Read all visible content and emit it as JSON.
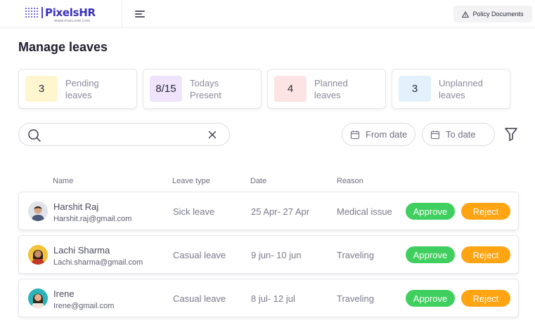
{
  "brand": {
    "name": "PixelsHR",
    "tagline": "WWW.PIXELSHR.COM"
  },
  "header": {
    "policy_label": "Policy Documents"
  },
  "page": {
    "title": "Manage leaves"
  },
  "stats": [
    {
      "value": "3",
      "label": "Pending leaves",
      "color": "#fff6cf"
    },
    {
      "value": "8/15",
      "label": "Todays Present",
      "color": "#efe4fb"
    },
    {
      "value": "4",
      "label": "Planned leaves",
      "color": "#fde4e4"
    },
    {
      "value": "3",
      "label": "Unplanned leaves",
      "color": "#e3f1fd"
    }
  ],
  "filters": {
    "search_value": "",
    "from_date_label": "From date",
    "to_date_label": "To date"
  },
  "table": {
    "columns": [
      "Name",
      "Leave type",
      "Date",
      "Reason"
    ],
    "approve_label": "Approve",
    "reject_label": "Reject",
    "rows": [
      {
        "name": "Harshit Raj",
        "email": "Harshit.raj@gmail.com",
        "leave_type": "Sick leave",
        "date": "25 Apr- 27 Apr",
        "reason": "Medical issue"
      },
      {
        "name": "Lachi Sharma",
        "email": "Lachi.sharma@gmail.com",
        "leave_type": "Casual leave",
        "date": "9 jun- 10 jun",
        "reason": "Traveling"
      },
      {
        "name": "Irene",
        "email": "Irene@gmail.com",
        "leave_type": "Casual leave",
        "date": "8 jul- 12 jul",
        "reason": "Traveling"
      }
    ]
  },
  "icons": {
    "menu": "hamburger-menu-icon",
    "policy": "warning-triangle-icon",
    "search": "search-icon",
    "clear": "close-icon",
    "calendar": "calendar-icon",
    "filter": "filter-funnel-icon"
  },
  "colors": {
    "accent": "#3c32b8",
    "approve": "#3fcf5e",
    "reject": "#ffa412"
  }
}
